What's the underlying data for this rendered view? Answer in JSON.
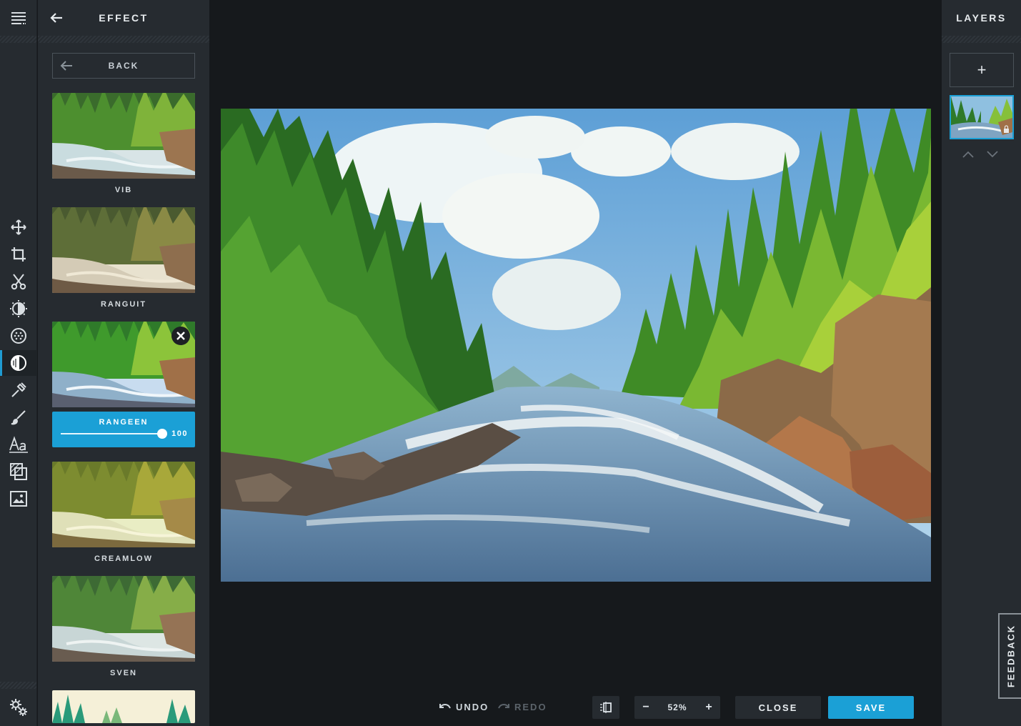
{
  "rail": {
    "menu_icon": "hamburger-menu-icon",
    "tools": [
      {
        "name": "move",
        "icon": "move-arrows-icon",
        "active": false
      },
      {
        "name": "crop",
        "icon": "crop-icon",
        "active": false
      },
      {
        "name": "cut",
        "icon": "scissors-icon",
        "active": false
      },
      {
        "name": "adjust",
        "icon": "adjust-sun-icon",
        "active": false
      },
      {
        "name": "filter",
        "icon": "filter-dots-icon",
        "active": false
      },
      {
        "name": "effect",
        "icon": "effect-half-circle-icon",
        "active": true
      },
      {
        "name": "picker",
        "icon": "eyedropper-icon",
        "active": false
      },
      {
        "name": "brush",
        "icon": "brush-icon",
        "active": false
      },
      {
        "name": "text",
        "icon": "text-aa-icon",
        "active": false
      },
      {
        "name": "overlay",
        "icon": "overlay-icon",
        "active": false
      },
      {
        "name": "image",
        "icon": "image-icon",
        "active": false
      }
    ],
    "settings_icon": "gears-icon"
  },
  "panel": {
    "title": "EFFECT",
    "back_label": "BACK",
    "effects": [
      {
        "label": "VIB"
      },
      {
        "label": "RANGUIT"
      },
      {
        "label": "RANGEEN",
        "active": true,
        "value": "100",
        "level": 1.0
      },
      {
        "label": "CREAMLOW"
      },
      {
        "label": "SVEN"
      }
    ]
  },
  "toolbar": {
    "undo": "UNDO",
    "redo": "REDO",
    "zoom_minus": "−",
    "zoom_level": "52%",
    "zoom_plus": "+",
    "close": "CLOSE",
    "save": "SAVE"
  },
  "layers": {
    "title": "LAYERS",
    "add": "+",
    "feedback": "FEEDBACK"
  },
  "colors": {
    "accent": "#1ba0d6",
    "panel": "#262b30",
    "background": "#16191c"
  }
}
